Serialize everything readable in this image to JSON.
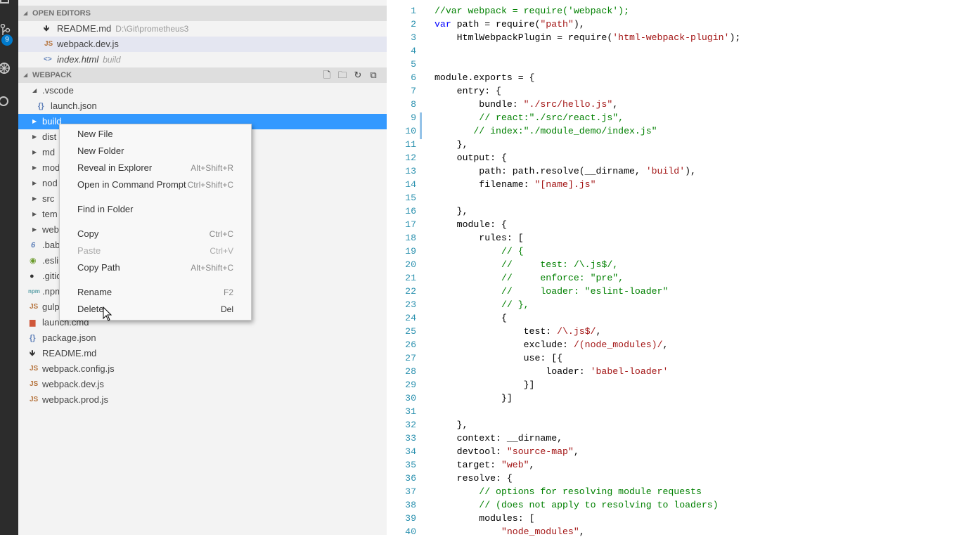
{
  "activity_bar": {
    "scm_badge": "9"
  },
  "open_editors": {
    "header": "OPEN EDITORS",
    "items": [
      {
        "icon": "🡻",
        "label": "README.md",
        "desc": "D:\\Git\\prometheus3"
      },
      {
        "icon": "JS",
        "label": "webpack.dev.js",
        "desc": ""
      },
      {
        "icon": "<>",
        "label": "index.html",
        "desc": "build"
      }
    ]
  },
  "explorer": {
    "header": "WEBPACK",
    "tree": [
      {
        "icon": "",
        "label": ".vscode"
      },
      {
        "icon": "{}",
        "label": "launch.json"
      },
      {
        "icon": "",
        "label": "build"
      },
      {
        "icon": "",
        "label": "dist"
      },
      {
        "icon": "",
        "label": "md"
      },
      {
        "icon": "",
        "label": "mod"
      },
      {
        "icon": "",
        "label": "nod"
      },
      {
        "icon": "",
        "label": "src"
      },
      {
        "icon": "",
        "label": "tem"
      },
      {
        "icon": "",
        "label": "web"
      },
      {
        "icon": "6",
        "label": ".bab"
      },
      {
        "icon": "◉",
        "label": ".eslir"
      },
      {
        "icon": "●",
        "label": ".gitic"
      },
      {
        "icon": "npm",
        "label": ".npm"
      },
      {
        "icon": "JS",
        "label": "gulp"
      },
      {
        "icon": "▆",
        "label": "launch.cmd"
      },
      {
        "icon": "{}",
        "label": "package.json"
      },
      {
        "icon": "🡻",
        "label": "README.md"
      },
      {
        "icon": "JS",
        "label": "webpack.config.js"
      },
      {
        "icon": "JS",
        "label": "webpack.dev.js"
      },
      {
        "icon": "JS",
        "label": "webpack.prod.js"
      }
    ]
  },
  "context_menu": {
    "items": [
      {
        "label": "New File",
        "shortcut": ""
      },
      {
        "label": "New Folder",
        "shortcut": ""
      },
      {
        "label": "Reveal in Explorer",
        "shortcut": "Alt+Shift+R"
      },
      {
        "label": "Open in Command Prompt",
        "shortcut": "Ctrl+Shift+C"
      },
      {
        "label": "Find in Folder",
        "shortcut": ""
      },
      {
        "label": "Copy",
        "shortcut": "Ctrl+C"
      },
      {
        "label": "Paste",
        "shortcut": "Ctrl+V"
      },
      {
        "label": "Copy Path",
        "shortcut": "Alt+Shift+C"
      },
      {
        "label": "Rename",
        "shortcut": "F2"
      },
      {
        "label": "Delete",
        "shortcut": "Del"
      }
    ]
  },
  "editor": {
    "lines": [
      [
        [
          "c",
          "//var webpack = require('webpack');"
        ]
      ],
      [
        [
          "k",
          "var"
        ],
        [
          "p",
          " path = require("
        ],
        [
          "s",
          "\"path\""
        ],
        [
          "p",
          "),"
        ]
      ],
      [
        [
          "p",
          "    HtmlWebpackPlugin = require("
        ],
        [
          "s",
          "'html-webpack-plugin'"
        ],
        [
          "p",
          ");"
        ]
      ],
      [
        [
          "p",
          ""
        ]
      ],
      [
        [
          "p",
          ""
        ]
      ],
      [
        [
          "p",
          "module.exports = {"
        ]
      ],
      [
        [
          "p",
          "    entry: {"
        ]
      ],
      [
        [
          "p",
          "        bundle: "
        ],
        [
          "s",
          "\"./src/hello.js\""
        ],
        [
          "p",
          ","
        ]
      ],
      [
        [
          "c",
          "        // react:\"./src/react.js\","
        ]
      ],
      [
        [
          "c",
          "       // index:\"./module_demo/index.js\""
        ]
      ],
      [
        [
          "p",
          "    },"
        ]
      ],
      [
        [
          "p",
          "    output: {"
        ]
      ],
      [
        [
          "p",
          "        path: path.resolve(__dirname, "
        ],
        [
          "s",
          "'build'"
        ],
        [
          "p",
          "),"
        ]
      ],
      [
        [
          "p",
          "        filename: "
        ],
        [
          "s",
          "\"[name].js\""
        ]
      ],
      [
        [
          "p",
          ""
        ]
      ],
      [
        [
          "p",
          "    },"
        ]
      ],
      [
        [
          "p",
          "    module: {"
        ]
      ],
      [
        [
          "p",
          "        rules: ["
        ]
      ],
      [
        [
          "c",
          "            // {"
        ]
      ],
      [
        [
          "c",
          "            //     test: /\\.js$/,"
        ]
      ],
      [
        [
          "c",
          "            //     enforce: \"pre\","
        ]
      ],
      [
        [
          "c",
          "            //     loader: \"eslint-loader\""
        ]
      ],
      [
        [
          "c",
          "            // },"
        ]
      ],
      [
        [
          "p",
          "            {"
        ]
      ],
      [
        [
          "p",
          "                test: "
        ],
        [
          "s",
          "/\\.js$/"
        ],
        [
          "p",
          ","
        ]
      ],
      [
        [
          "p",
          "                exclude: "
        ],
        [
          "s",
          "/(node_modules)/"
        ],
        [
          "p",
          ","
        ]
      ],
      [
        [
          "p",
          "                use: [{"
        ]
      ],
      [
        [
          "p",
          "                    loader: "
        ],
        [
          "s",
          "'babel-loader'"
        ]
      ],
      [
        [
          "p",
          "                }]"
        ]
      ],
      [
        [
          "p",
          "            }]"
        ]
      ],
      [
        [
          "p",
          ""
        ]
      ],
      [
        [
          "p",
          "    },"
        ]
      ],
      [
        [
          "p",
          "    context: __dirname,"
        ]
      ],
      [
        [
          "p",
          "    devtool: "
        ],
        [
          "s",
          "\"source-map\""
        ],
        [
          "p",
          ","
        ]
      ],
      [
        [
          "p",
          "    target: "
        ],
        [
          "s",
          "\"web\""
        ],
        [
          "p",
          ","
        ]
      ],
      [
        [
          "p",
          "    resolve: {"
        ]
      ],
      [
        [
          "c",
          "        // options for resolving module requests"
        ]
      ],
      [
        [
          "c",
          "        // (does not apply to resolving to loaders)"
        ]
      ],
      [
        [
          "p",
          "        modules: ["
        ]
      ],
      [
        [
          "s",
          "            \"node_modules\""
        ],
        [
          "p",
          ","
        ]
      ]
    ]
  }
}
